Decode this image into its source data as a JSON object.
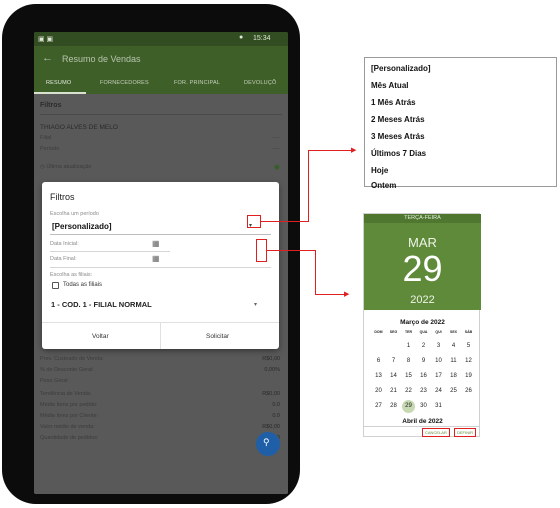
{
  "phone": {
    "status_bar": {
      "left_icons": "▣ ▣",
      "time": "15:34"
    },
    "app_bar": {
      "title": "Resumo de Vendas"
    },
    "tabs": [
      {
        "label": "RESUMO"
      },
      {
        "label": "FORNECEDORES"
      },
      {
        "label": "FOR. PRINCIPAL"
      },
      {
        "label": "DEVOLUÇÕ"
      }
    ],
    "summary": {
      "section_title": "Filtros",
      "user_name": "THIAGO ALVES DE MELO",
      "filial_label": "Filial",
      "filial_value": "----",
      "periodo_label": "Período",
      "periodo_value": "----",
      "last_update": "Última atualização"
    },
    "stats": [
      {
        "label": "Prev. Custeado de Venda:",
        "value": "R$0,00"
      },
      {
        "label": "% de Desconto Geral:",
        "value": "0,00%"
      },
      {
        "label": "Peso Geral:",
        "value": ""
      },
      {
        "label": "Tendência de Venda:",
        "value": "R$0,00"
      },
      {
        "label": "Média Itens por pedido:",
        "value": "0.0"
      },
      {
        "label": "Média Itens por Cliente:",
        "value": "0.0"
      },
      {
        "label": "Valor médio de venda:",
        "value": "R$0,00"
      },
      {
        "label": "Quantidade de pedidos:",
        "value": "0.0"
      }
    ],
    "dialog": {
      "title": "Filtros",
      "period_label": "Escolha um período",
      "period_value": "[Personalizado]",
      "start_date_label": "Data Inicial:",
      "end_date_label": "Data Final:",
      "filial_label": "Escolha as filiais:",
      "all_filiais_label": "Todas as filiais",
      "filial_value": "1 - COD. 1 - FILIAL NORMAL",
      "back_button": "Voltar",
      "request_button": "Solicitar"
    }
  },
  "period_options": [
    "[Personalizado]",
    "Mês Atual",
    "1 Mês Atrás",
    "2 Meses Atrás",
    "3 Meses Atrás",
    "Últimos 7 Dias",
    "Hoje",
    "Ontem"
  ],
  "date_picker": {
    "weekday": "TERÇA-FEIRA",
    "month": "MAR",
    "day": "29",
    "year": "2022",
    "current_month_title": "Março de 2022",
    "weekdays": [
      "DOM",
      "SEG",
      "TER",
      "QUA",
      "QUI",
      "SEX",
      "SÁB"
    ],
    "weeks": [
      [
        "",
        "",
        "1",
        "2",
        "3",
        "4",
        "5"
      ],
      [
        "6",
        "7",
        "8",
        "9",
        "10",
        "11",
        "12"
      ],
      [
        "13",
        "14",
        "15",
        "16",
        "17",
        "18",
        "19"
      ],
      [
        "20",
        "21",
        "22",
        "23",
        "24",
        "25",
        "26"
      ],
      [
        "27",
        "28",
        "29",
        "30",
        "31",
        "",
        ""
      ]
    ],
    "selected_day": "29",
    "next_month_title": "Abril de 2022",
    "cancel_button": "CANCELAR",
    "set_button": "DEFINIR"
  },
  "colors": {
    "app_green": "#3f5f29",
    "picker_green": "#5e8a3a",
    "annotation_red": "#e02020"
  }
}
